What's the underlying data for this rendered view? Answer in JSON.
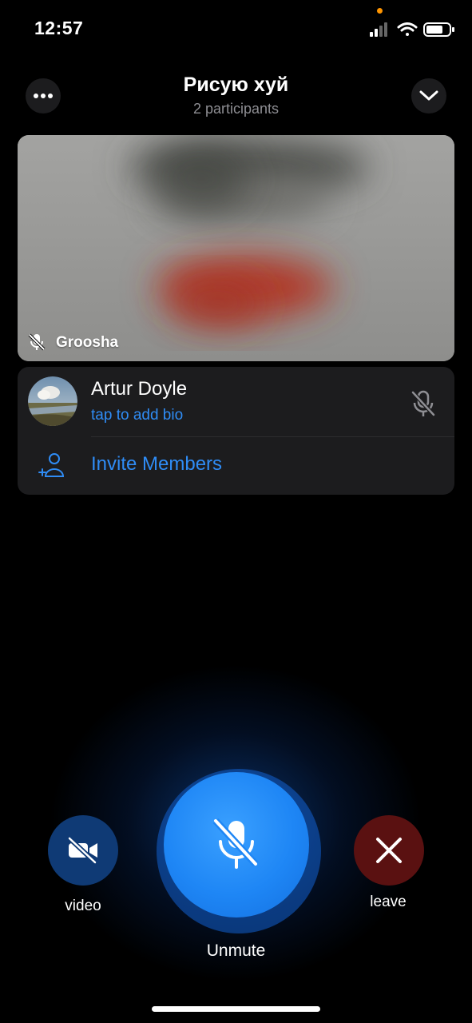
{
  "status_bar": {
    "time": "12:57"
  },
  "header": {
    "title": "Рисую хуй",
    "subtitle": "2 participants",
    "menu_icon": "ellipsis-icon",
    "collapse_icon": "chevron-down-icon"
  },
  "video_tile": {
    "participant_name": "Groosha",
    "muted": true
  },
  "participants": [
    {
      "name": "Artur Doyle",
      "bio": "tap to add bio",
      "muted": true
    }
  ],
  "invite": {
    "label": "Invite Members"
  },
  "controls": {
    "video_label": "video",
    "mic_label": "Unmute",
    "leave_label": "leave"
  },
  "colors": {
    "accent": "#2f8cf5",
    "mic_button": "#1e86f5",
    "leave_button": "#5a1111",
    "video_button": "#0f3a75"
  }
}
